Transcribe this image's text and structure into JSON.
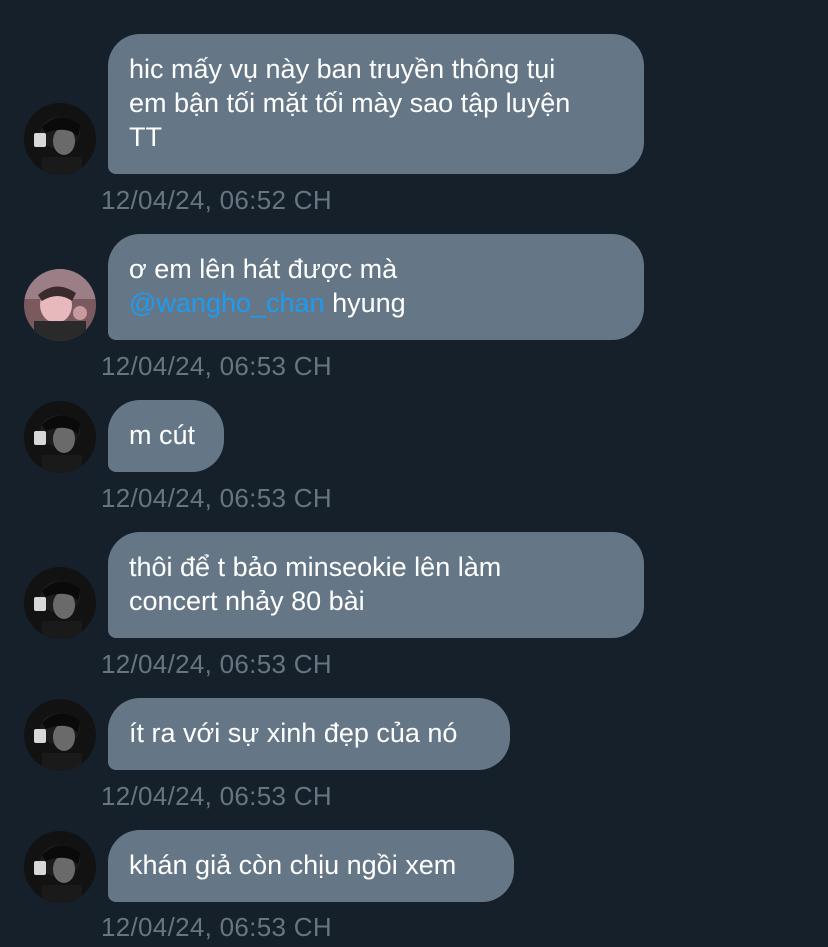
{
  "messages": [
    {
      "sender": "wangho_chan",
      "avatar": "avatar-dark-hair",
      "lines": [
        "hic mấy vụ này ban truyền thông tụi",
        "em bận tối mặt tối mày sao tập luyện",
        "TT"
      ],
      "time": "12/04/24, 06:52 CH"
    },
    {
      "sender": "other",
      "avatar": "avatar-pink-photo",
      "lines": [
        "ơ em lên hát được mà"
      ],
      "mention": "@wangho_chan",
      "after_mention": " hyung",
      "time": "12/04/24, 06:53 CH"
    },
    {
      "sender": "wangho_chan",
      "avatar": "avatar-dark-hair",
      "lines": [
        "m cút"
      ],
      "time": "12/04/24, 06:53 CH"
    },
    {
      "sender": "wangho_chan",
      "avatar": "avatar-dark-hair",
      "lines": [
        "thôi để t bảo minseokie lên làm",
        "concert nhảy 80 bài"
      ],
      "time": "12/04/24, 06:53 CH"
    },
    {
      "sender": "wangho_chan",
      "avatar": "avatar-dark-hair",
      "lines": [
        "ít ra với sự xinh đẹp của nó"
      ],
      "time": "12/04/24, 06:53 CH"
    },
    {
      "sender": "wangho_chan",
      "avatar": "avatar-dark-hair",
      "lines": [
        "khán giả còn chịu ngồi xem"
      ],
      "time": "12/04/24, 06:53 CH"
    }
  ],
  "colors": {
    "background": "#15202b",
    "bubble": "#657786",
    "timestamp": "#66757f",
    "mention": "#1d9bf0"
  }
}
